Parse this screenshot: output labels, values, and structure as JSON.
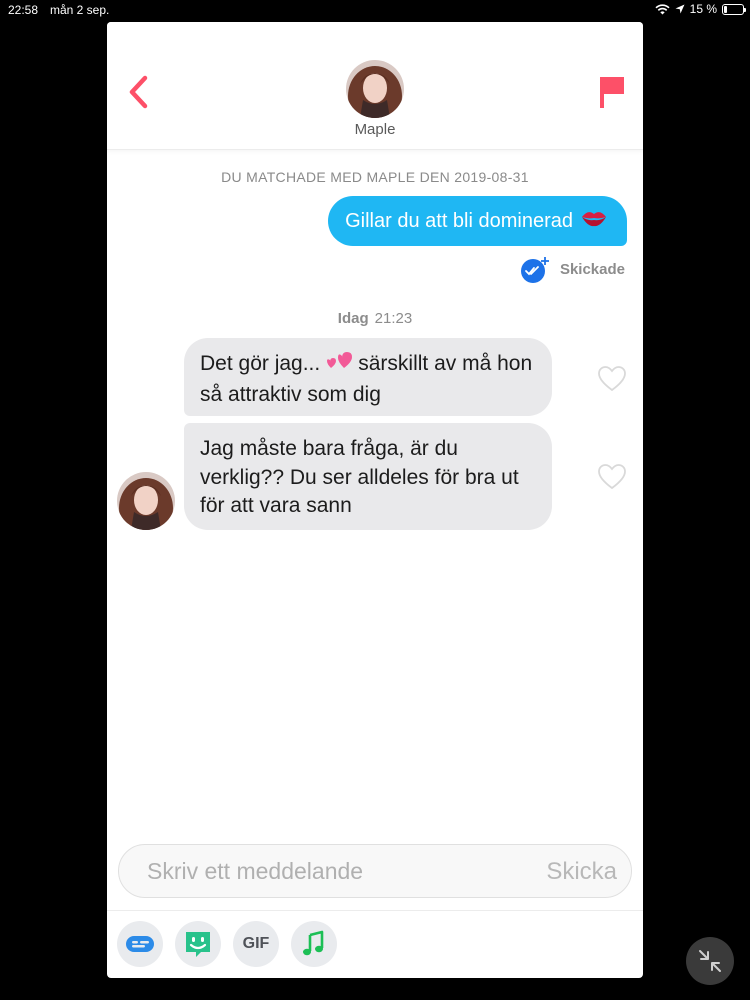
{
  "status_bar": {
    "time": "22:58",
    "date": "mån 2 sep.",
    "battery_percent": "15 %",
    "battery_level": 0.15
  },
  "header": {
    "match_name": "Maple",
    "back_icon": "chevron-left-icon",
    "report_icon": "flag-icon"
  },
  "conversation": {
    "match_info": "DU MATCHADE MED MAPLE DEN 2019-08-31",
    "outgoing": {
      "text": "Gillar du att bli dominerad",
      "emoji": "💋",
      "status": "Skickade"
    },
    "day_stamp": {
      "day": "Idag",
      "time": "21:23"
    },
    "incoming": [
      {
        "text_before": "Det gör jag...",
        "emoji": "💕",
        "text_after": "särskillt av må hon så attraktiv som dig"
      },
      {
        "text": "Jag måste bara fråga, är du verklig?? Du ser alldeles för bra ut för att vara sann"
      }
    ]
  },
  "composer": {
    "placeholder": "Skriv ett meddelande",
    "send_label": "Skicka"
  },
  "toolbar": {
    "gif_label": "GIF",
    "items": [
      "sticker-icon",
      "bitmoji-icon",
      "gif-icon",
      "music-icon"
    ]
  },
  "colors": {
    "accent": "#fd5068",
    "outgoing_bubble": "#1fb7f3",
    "incoming_bubble": "#e9e9eb",
    "read_receipt": "#1d72e8",
    "sticker_icon": "#2c8be8",
    "bitmoji_icon": "#28c28b",
    "music_icon": "#1cbf55"
  }
}
